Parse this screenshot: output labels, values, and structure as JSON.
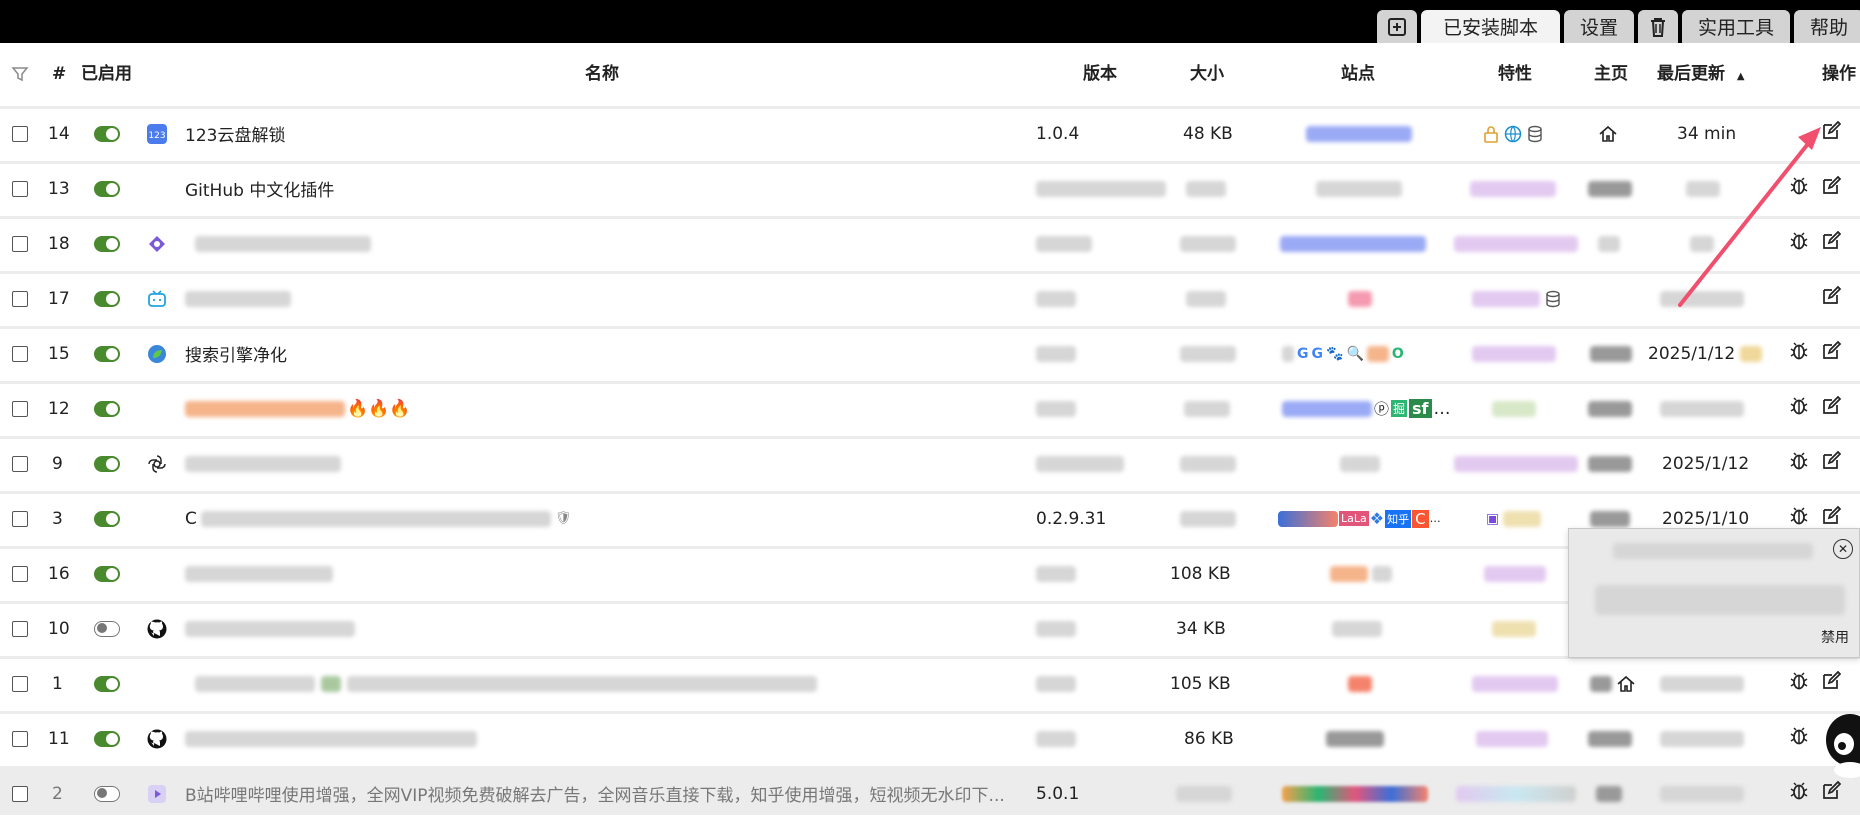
{
  "tabs": [
    {
      "icon": "plus-square-icon"
    },
    {
      "label": "已安装脚本",
      "active": true
    },
    {
      "label": "设置"
    },
    {
      "icon": "trash-icon"
    },
    {
      "label": "实用工具"
    },
    {
      "label": "帮助"
    }
  ],
  "header": {
    "num": "#",
    "enabled": "已启用",
    "name": "名称",
    "version": "版本",
    "size": "大小",
    "sites": "站点",
    "features": "特性",
    "homepage": "主页",
    "last_updated": "最后更新",
    "sort_indicator": "▲",
    "actions": "操作"
  },
  "rows": [
    {
      "num": "14",
      "name": "123云盘解锁",
      "version": "1.0.4",
      "size": "48 KB",
      "updated": "34 min"
    },
    {
      "num": "13",
      "name": "GitHub 中文化插件",
      "version": "",
      "size": "",
      "updated": ""
    },
    {
      "num": "18",
      "name": "",
      "version": "",
      "size": "",
      "updated": ""
    },
    {
      "num": "17",
      "name": "",
      "version": "",
      "size": "",
      "updated": ""
    },
    {
      "num": "15",
      "name": "搜索引擎净化",
      "version": "",
      "size": "",
      "updated": "2025/1/12"
    },
    {
      "num": "12",
      "name": "🔥🔥🔥",
      "version": "",
      "size": "",
      "updated": ""
    },
    {
      "num": "9",
      "name": "",
      "version": "",
      "size": "",
      "updated": "2025/1/12"
    },
    {
      "num": "3",
      "name": "C",
      "version": "0.2.9.31",
      "size": "",
      "updated": "2025/1/10"
    },
    {
      "num": "16",
      "name": "",
      "version": "",
      "size": "108 KB",
      "updated": ""
    },
    {
      "num": "10",
      "name": "",
      "version": "",
      "size": "34 KB",
      "updated": ""
    },
    {
      "num": "1",
      "name": "",
      "version": "",
      "size": "105 KB",
      "updated": ""
    },
    {
      "num": "11",
      "name": "",
      "version": "",
      "size": "86 KB",
      "updated": ""
    },
    {
      "num": "2",
      "name": "B站哔哩哔哩使用增强，全网VIP视频免费破解去广告，全网音乐直接下载，知乎使用增强，短视频无水印下...",
      "version": "5.0.1",
      "size": "",
      "updated": ""
    }
  ],
  "popup": {
    "label": "禁用"
  },
  "colors": {
    "enabled": "#4a8a2e",
    "arrow": "#f0506e"
  }
}
